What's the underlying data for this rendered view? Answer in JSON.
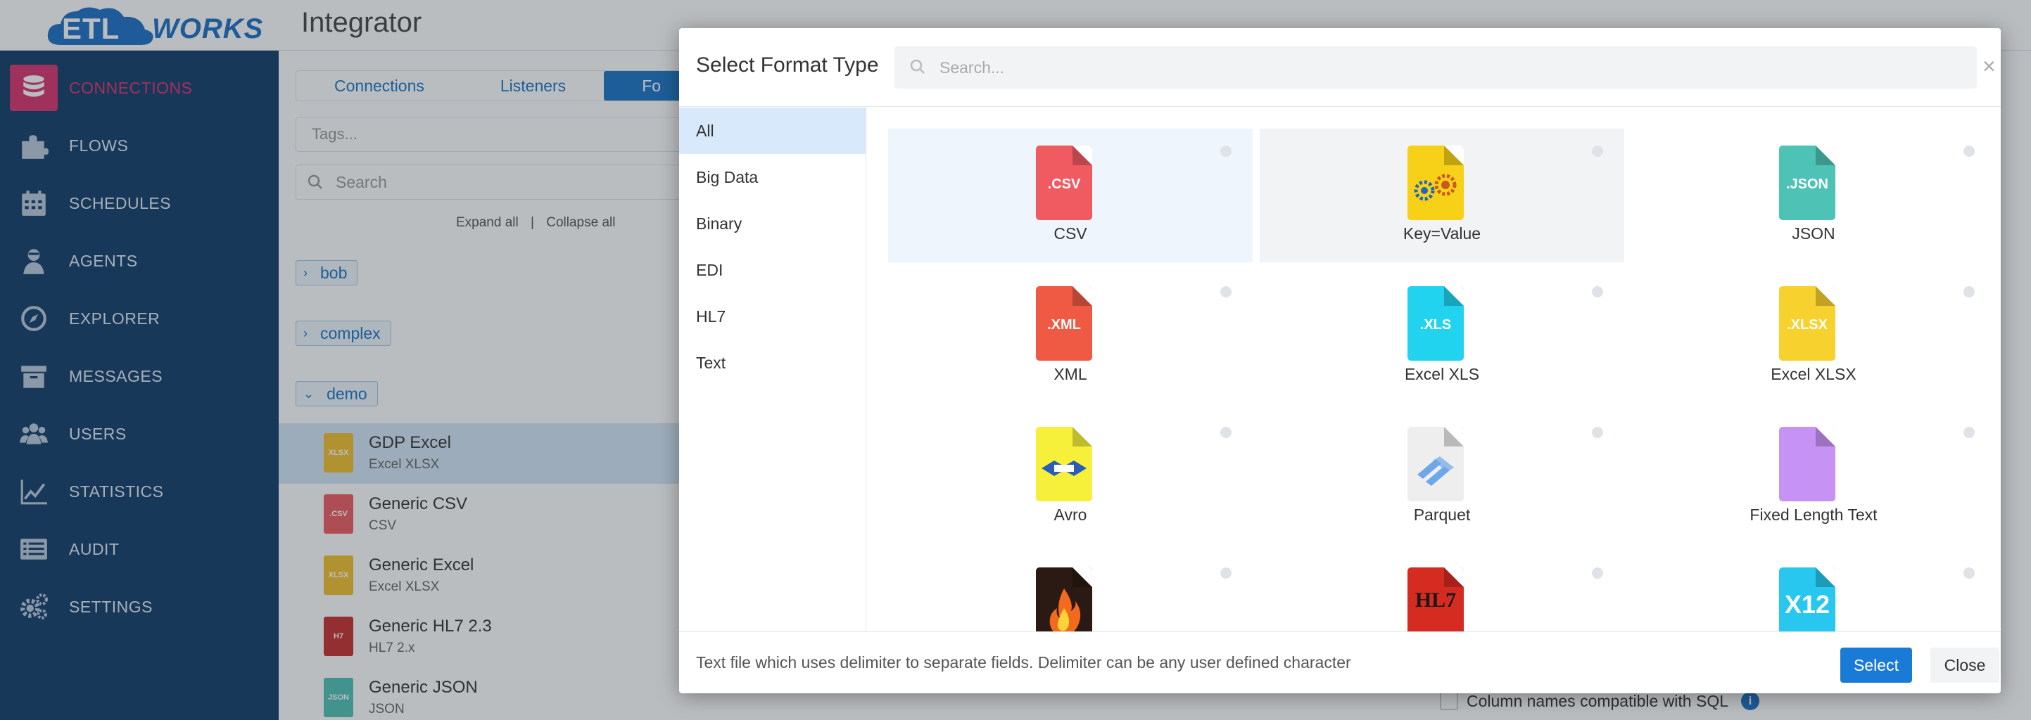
{
  "app": {
    "logo_left": "ETL",
    "logo_right": "WORKS",
    "title": "Integrator"
  },
  "sidebar": {
    "items": [
      {
        "label": "CONNECTIONS",
        "icon": "database-icon",
        "active": true
      },
      {
        "label": "FLOWS",
        "icon": "puzzle-icon"
      },
      {
        "label": "SCHEDULES",
        "icon": "calendar-icon"
      },
      {
        "label": "AGENTS",
        "icon": "agent-icon"
      },
      {
        "label": "EXPLORER",
        "icon": "compass-icon"
      },
      {
        "label": "MESSAGES",
        "icon": "archive-icon"
      },
      {
        "label": "USERS",
        "icon": "users-icon"
      },
      {
        "label": "STATISTICS",
        "icon": "chart-icon"
      },
      {
        "label": "AUDIT",
        "icon": "list-icon"
      },
      {
        "label": "SETTINGS",
        "icon": "gears-icon"
      }
    ]
  },
  "main": {
    "tabs": [
      {
        "label": "Connections"
      },
      {
        "label": "Listeners"
      },
      {
        "label": "Fo"
      }
    ],
    "tags_placeholder": "Tags...",
    "search_placeholder": "Search",
    "expand_all": "Expand all",
    "separator": "|",
    "collapse_all": "Collapse all",
    "folders": [
      {
        "name": "bob",
        "chevron": "›"
      },
      {
        "name": "complex",
        "chevron": "›"
      },
      {
        "name": "demo",
        "chevron": "⌄"
      }
    ],
    "connections": [
      {
        "name": "GDP Excel",
        "type": "Excel XLSX",
        "icon_text": "XLSX",
        "color": "#f2c02c"
      },
      {
        "name": "Generic CSV",
        "type": "CSV",
        "icon_text": ".CSV",
        "color": "#ef5b60"
      },
      {
        "name": "Generic Excel",
        "type": "Excel XLSX",
        "icon_text": "XLSX",
        "color": "#f2c02c"
      },
      {
        "name": "Generic HL7 2.3",
        "type": "HL7 2.x",
        "icon_text": "H7",
        "color": "#c62d2d"
      },
      {
        "name": "Generic JSON",
        "type": "JSON",
        "icon_text": "JSON",
        "color": "#4ec2b4"
      }
    ],
    "checkbox_label": "Column names compatible with SQL",
    "info_icon": "i"
  },
  "modal": {
    "title": "Select Format Type",
    "search_placeholder": "Search...",
    "close_x": "×",
    "categories": [
      {
        "label": "All",
        "active": true
      },
      {
        "label": "Big Data"
      },
      {
        "label": "Binary"
      },
      {
        "label": "EDI"
      },
      {
        "label": "HL7"
      },
      {
        "label": "Text"
      }
    ],
    "formats": [
      {
        "label": "CSV",
        "icon_text": ".CSV",
        "color": "#ef5b60"
      },
      {
        "label": "Key=Value",
        "icon_text": "",
        "color": "#f7d117"
      },
      {
        "label": "JSON",
        "icon_text": ".JSON",
        "color": "#4ec2b4"
      },
      {
        "label": "XML",
        "icon_text": ".XML",
        "color": "#ee5a44"
      },
      {
        "label": "Excel XLS",
        "icon_text": ".XLS",
        "color": "#22d3f0"
      },
      {
        "label": "Excel XLSX",
        "icon_text": ".XLSX",
        "color": "#f7d12e"
      },
      {
        "label": "Avro",
        "icon_text": "",
        "color": "#f7f03a"
      },
      {
        "label": "Parquet",
        "icon_text": "",
        "color": "#eeeeee"
      },
      {
        "label": "Fixed Length Text",
        "icon_text": "",
        "color": "#c693f5"
      },
      {
        "label": "",
        "icon_text": "",
        "color": "#2b1a14"
      },
      {
        "label": "",
        "icon_text": "HL7",
        "color": "#d52b20"
      },
      {
        "label": "",
        "icon_text": "X12",
        "color": "#27c7f0"
      }
    ],
    "description": "Text file which uses delimiter to separate fields. Delimiter can be any user defined character",
    "select_button": "Select",
    "close_button": "Close"
  }
}
